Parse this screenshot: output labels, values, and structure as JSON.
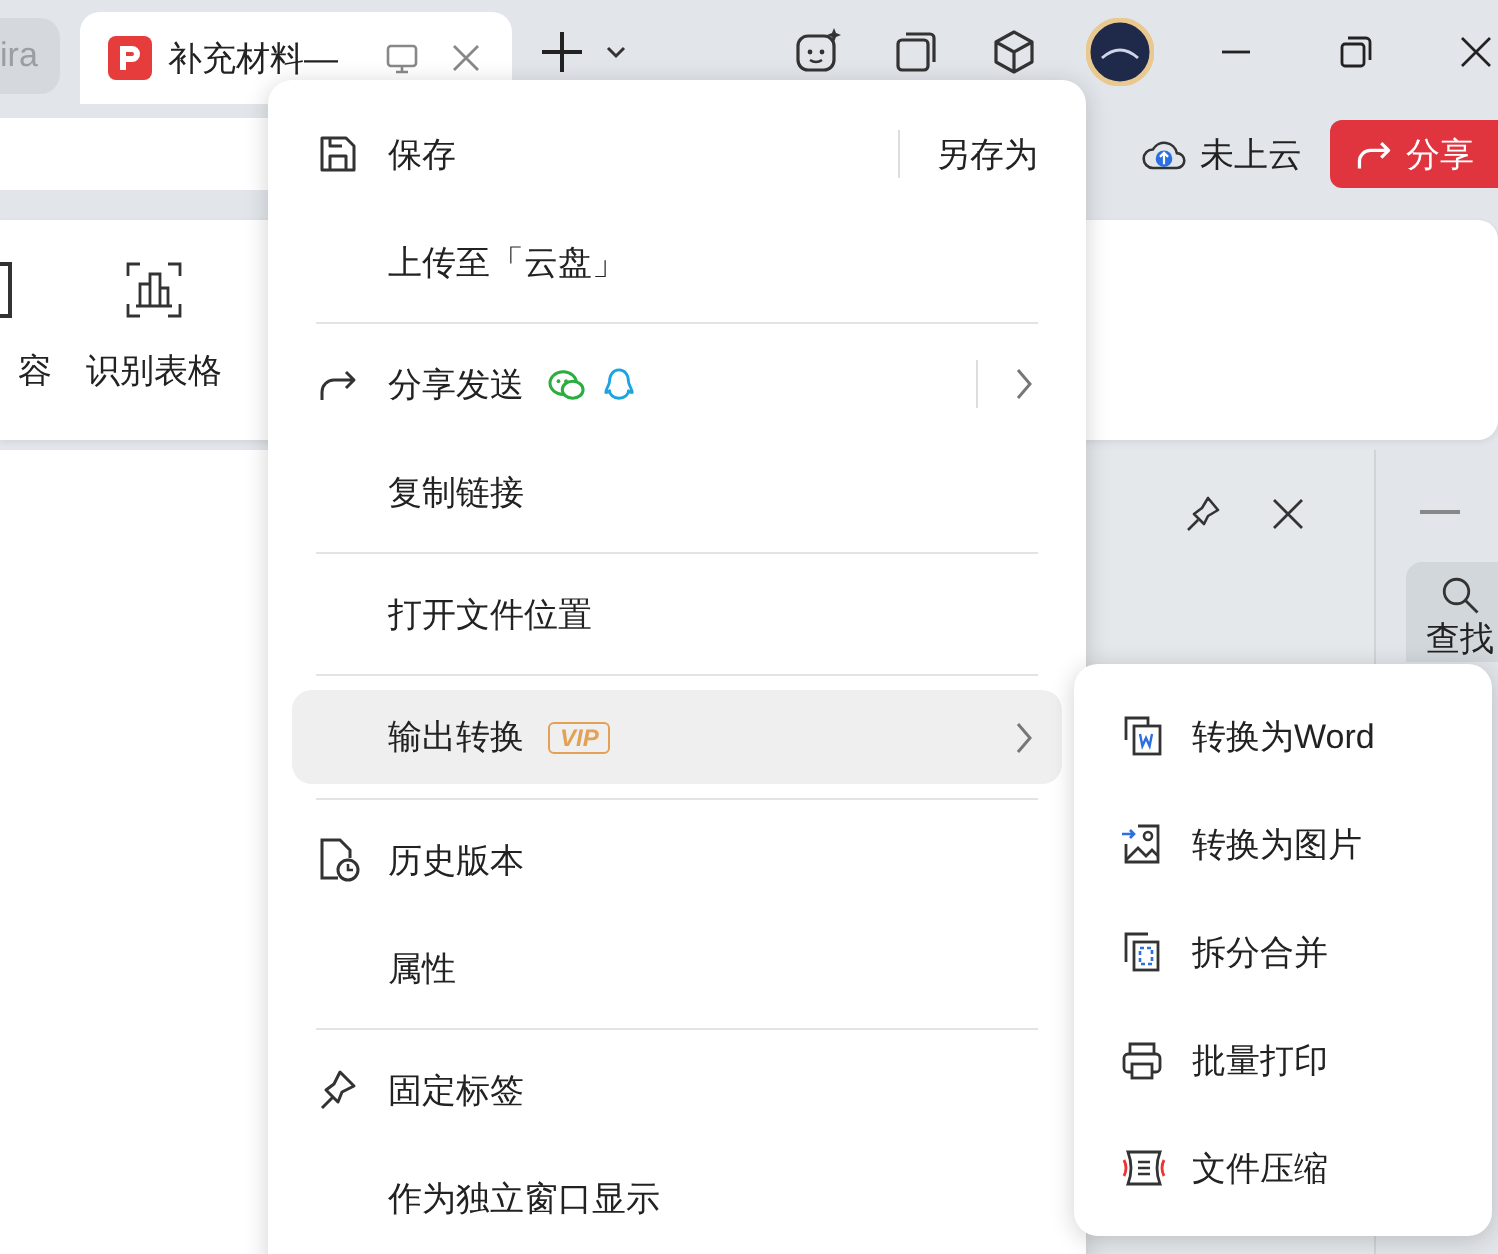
{
  "tabs": [
    {
      "title": "ira",
      "selected": false
    },
    {
      "title": "补充材料—",
      "selected": true
    }
  ],
  "cloud_status": "未上云",
  "share_button": "分享",
  "toolbar": [
    "容",
    "识别表格"
  ],
  "side_panel": {
    "search": "查找"
  },
  "menu": {
    "groups": [
      [
        {
          "label": "保存",
          "secondary": "另存为",
          "submenu": false,
          "selected": false
        },
        {
          "label": "上传至「云盘」",
          "submenu": false,
          "selected": false
        }
      ],
      [
        {
          "label": "分享发送",
          "submenu": true,
          "selected": false
        },
        {
          "label": "复制链接",
          "submenu": false,
          "selected": false
        }
      ],
      [
        {
          "label": "打开文件位置",
          "submenu": false,
          "selected": false
        }
      ],
      [
        {
          "label": "输出转换",
          "badge": "VIP",
          "submenu": true,
          "selected": true
        }
      ],
      [
        {
          "label": "历史版本",
          "submenu": false,
          "selected": false
        },
        {
          "label": "属性",
          "submenu": false,
          "selected": false
        }
      ],
      [
        {
          "label": "固定标签",
          "submenu": false,
          "selected": false
        },
        {
          "label": "作为独立窗口显示",
          "submenu": false,
          "selected": false
        }
      ]
    ]
  },
  "submenu": {
    "items": [
      "转换为Word",
      "转换为图片",
      "拆分合并",
      "批量打印",
      "文件压缩"
    ]
  }
}
